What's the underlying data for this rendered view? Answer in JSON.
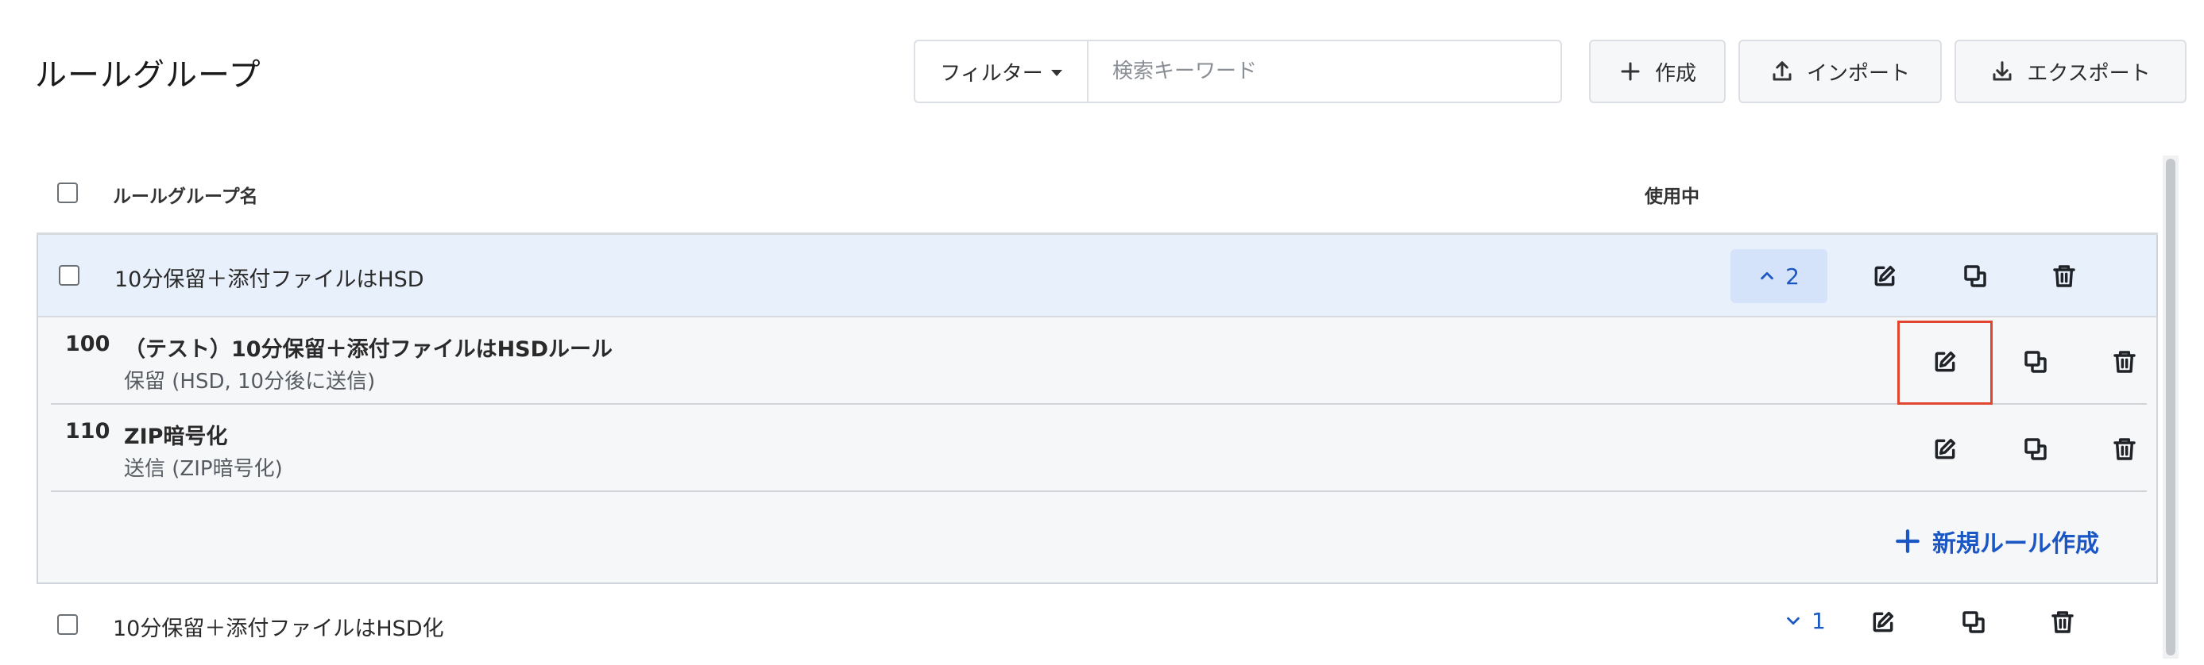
{
  "page": {
    "title": "ルールグループ"
  },
  "toolbar": {
    "filter_label": "フィルター",
    "search_placeholder": "検索キーワード",
    "create_label": "作成",
    "import_label": "インポート",
    "export_label": "エクスポート"
  },
  "table": {
    "headers": {
      "name": "ルールグループ名",
      "in_use": "使用中"
    },
    "groups": [
      {
        "name": "10分保留＋添付ファイルはHSD",
        "count": "2",
        "expanded": true,
        "rules": [
          {
            "number": "100",
            "title": "（テスト）10分保留＋添付ファイルはHSDルール",
            "subtitle": "保留 (HSD, 10分後に送信)"
          },
          {
            "number": "110",
            "title": "ZIP暗号化",
            "subtitle": "送信 (ZIP暗号化)"
          }
        ],
        "new_rule_label": "新規ルール作成"
      },
      {
        "name": "10分保留＋添付ファイルはHSD化",
        "count": "1",
        "expanded": false
      }
    ]
  },
  "colors": {
    "accent": "#1a56c4",
    "highlight": "#e0452f",
    "expanded_row": "#e8f0fb"
  }
}
